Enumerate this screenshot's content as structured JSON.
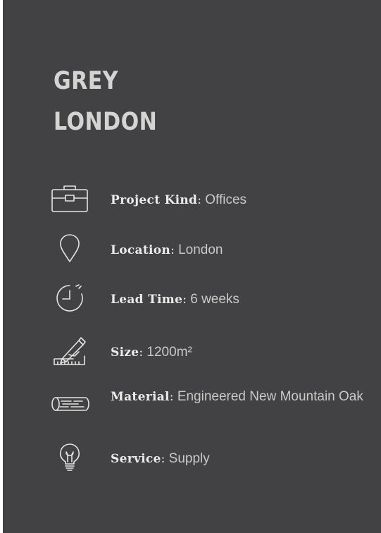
{
  "project": {
    "title_line1": "GREY",
    "title_line2": "LONDON"
  },
  "details": [
    {
      "icon": "briefcase-icon",
      "label": "Project Kind",
      "value": "Offices"
    },
    {
      "icon": "location-pin-icon",
      "label": "Location",
      "value": "London"
    },
    {
      "icon": "stopwatch-icon",
      "label": "Lead Time",
      "value": "6 weeks"
    },
    {
      "icon": "pencil-ruler-icon",
      "label": "Size",
      "value": "1200m²"
    },
    {
      "icon": "timber-log-icon",
      "label": "Material",
      "value": "Engineered New Mountain Oak"
    },
    {
      "icon": "lightbulb-icon",
      "label": "Service",
      "value": "Supply"
    }
  ],
  "colors": {
    "background": "#424143",
    "title": "#d4d4d2",
    "label": "#ebebea",
    "value": "#c9c9c7"
  }
}
